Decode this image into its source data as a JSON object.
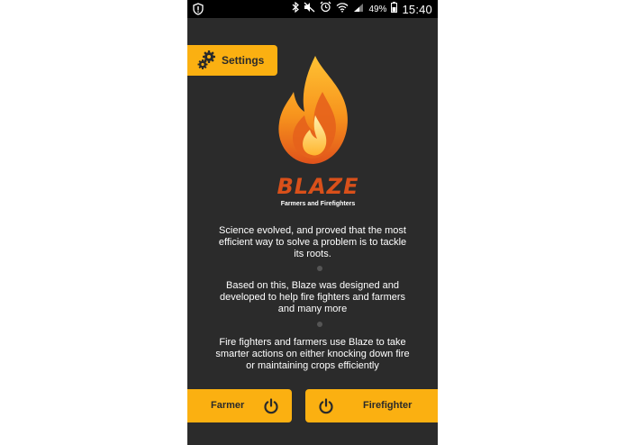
{
  "status_bar": {
    "battery_percent": "49%",
    "time": "15:40",
    "icons": [
      "alert-icon",
      "bluetooth-icon",
      "mute-icon",
      "alarm-icon",
      "wifi-icon",
      "signal-icon",
      "battery-icon"
    ]
  },
  "settings": {
    "label": "Settings",
    "icon": "gears-icon"
  },
  "logo": {
    "brand": "BLAZE",
    "tagline": "Farmers and Firefighters"
  },
  "intro": {
    "paragraphs": [
      "Science evolved, and proved that the most efficient way to solve a problem is to tackle its roots.",
      "Based on this, Blaze was designed and developed to help fire fighters and farmers and many more",
      "Fire fighters and farmers use Blaze to take smarter actions on either knocking down fire or maintaining crops efficiently"
    ]
  },
  "actions": {
    "farmer_label": "Farmer",
    "firefighter_label": "Firefighter",
    "icon": "power-icon"
  },
  "colors": {
    "accent": "#fbb011",
    "background": "#2b2b2b",
    "status_bar": "#000000",
    "brand_red": "#d9501a",
    "flame_orange": "#f7941d"
  }
}
